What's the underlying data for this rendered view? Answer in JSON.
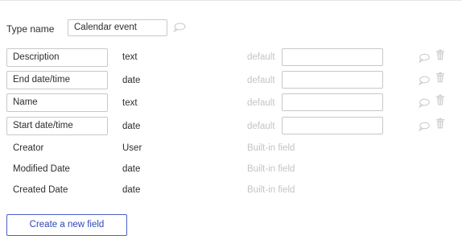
{
  "type": {
    "label": "Type name",
    "value": "Calendar event"
  },
  "default_label": "default",
  "fields": [
    {
      "name": "Description",
      "type": "text"
    },
    {
      "name": "End date/time",
      "type": "date"
    },
    {
      "name": "Name",
      "type": "text"
    },
    {
      "name": "Start date/time",
      "type": "date"
    }
  ],
  "builtin_fields": [
    {
      "name": "Creator",
      "type": "User",
      "note": "Built-in field"
    },
    {
      "name": "Modified Date",
      "type": "date",
      "note": "Built-in field"
    },
    {
      "name": "Created Date",
      "type": "date",
      "note": "Built-in field"
    }
  ],
  "create_button_label": "Create a new field",
  "icons": {
    "comment": "speech-bubble-icon",
    "delete": "trash-icon"
  },
  "colors": {
    "accent": "#2f48b6",
    "muted": "#c4c4c4",
    "border": "#c8c8c8"
  }
}
